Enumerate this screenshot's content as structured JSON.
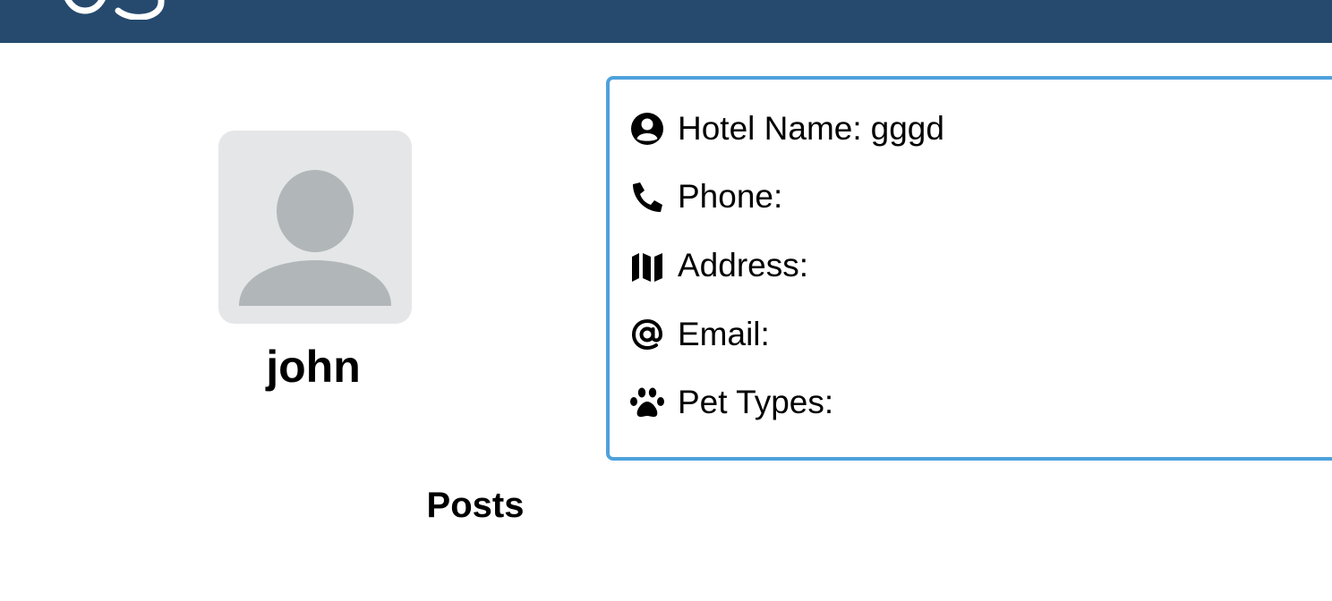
{
  "header": {
    "background_color": "#254a6e",
    "logo_icon": "brand-logo-icon"
  },
  "profile": {
    "avatar_icon": "user-placeholder-icon",
    "username": "john"
  },
  "info_card": {
    "border_color": "#4ea1dc",
    "rows": [
      {
        "icon": "user-circle-icon",
        "label": "Hotel Name:",
        "value": "gggd"
      },
      {
        "icon": "phone-icon",
        "label": "Phone:",
        "value": ""
      },
      {
        "icon": "map-icon",
        "label": "Address:",
        "value": ""
      },
      {
        "icon": "at-sign-icon",
        "label": "Email:",
        "value": ""
      },
      {
        "icon": "paw-icon",
        "label": "Pet Types:",
        "value": ""
      }
    ]
  },
  "posts": {
    "heading": "Posts"
  }
}
